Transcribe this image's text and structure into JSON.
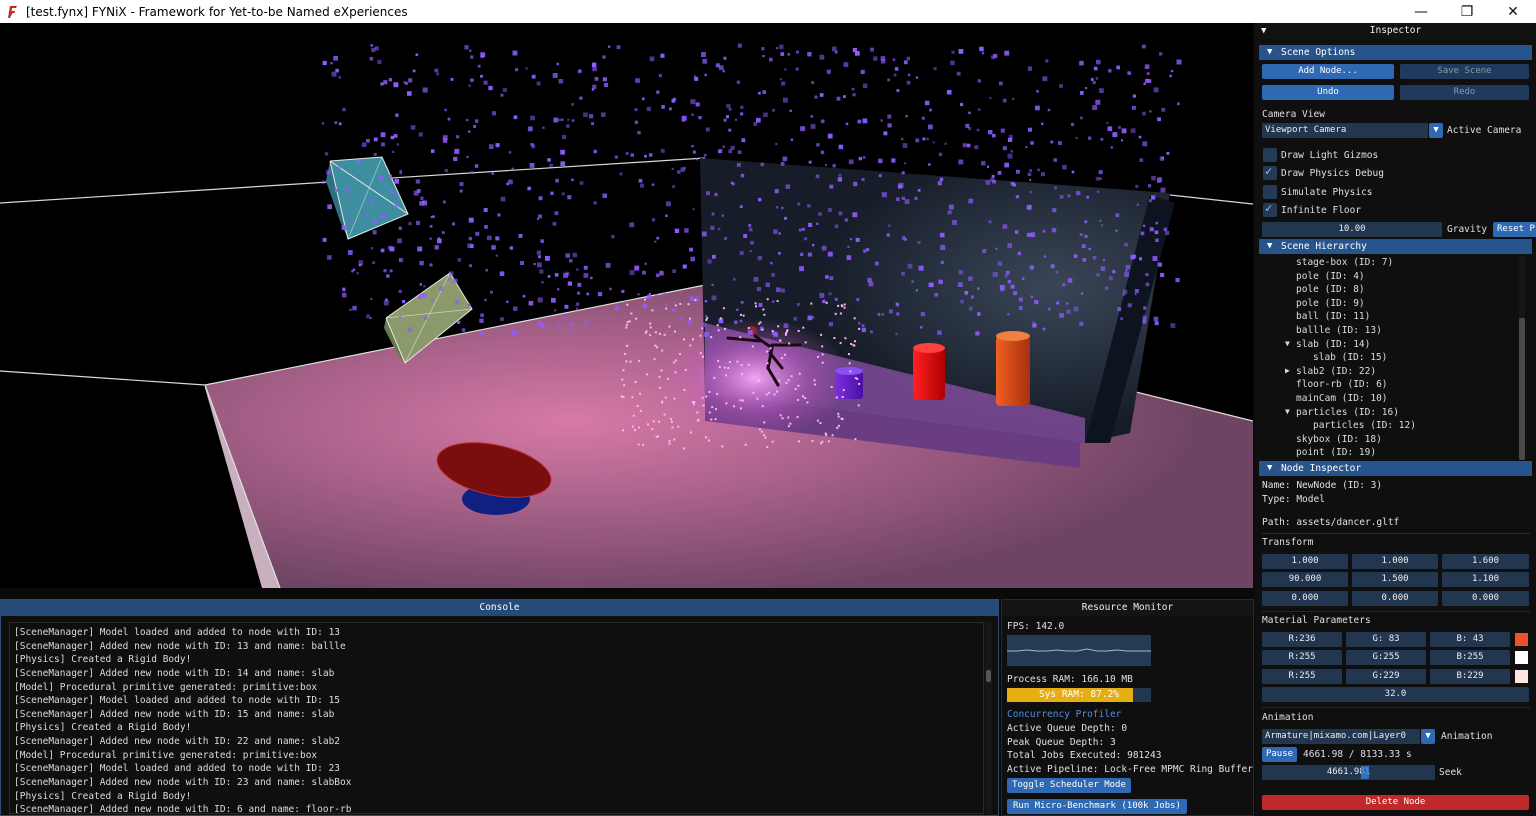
{
  "window": {
    "title": "[test.fynx] FYNiX - Framework for Yet-to-be Named eXperiences",
    "min_glyph": "—",
    "max_glyph": "❐",
    "close_glyph": "✕"
  },
  "inspector": {
    "title": "Inspector",
    "scene_options": {
      "header": "Scene Options",
      "add_node": "Add Node...",
      "save_scene": "Save Scene",
      "undo": "Undo",
      "redo": "Redo",
      "camera_view_label": "Camera View",
      "camera_select": "Viewport Camera",
      "active_camera_label": "Active Camera",
      "checkboxes": [
        {
          "label": "Draw Light Gizmos",
          "checked": false
        },
        {
          "label": "Draw Physics Debug",
          "checked": true
        },
        {
          "label": "Simulate Physics",
          "checked": false
        },
        {
          "label": "Infinite Floor",
          "checked": true
        }
      ],
      "gravity_value": "10.00",
      "gravity_label": "Gravity",
      "reset_label": "Reset P"
    },
    "scene_hierarchy": {
      "header": "Scene Hierarchy",
      "items": [
        {
          "label": "stage-box (ID: 7)",
          "depth": 0,
          "arrow": ""
        },
        {
          "label": "pole (ID: 4)",
          "depth": 0,
          "arrow": ""
        },
        {
          "label": "pole (ID: 8)",
          "depth": 0,
          "arrow": ""
        },
        {
          "label": "pole (ID: 9)",
          "depth": 0,
          "arrow": ""
        },
        {
          "label": "ball (ID: 11)",
          "depth": 0,
          "arrow": ""
        },
        {
          "label": "ballle (ID: 13)",
          "depth": 0,
          "arrow": ""
        },
        {
          "label": "slab (ID: 14)",
          "depth": 0,
          "arrow": "▼"
        },
        {
          "label": "slab (ID: 15)",
          "depth": 1,
          "arrow": ""
        },
        {
          "label": "slab2 (ID: 22)",
          "depth": 0,
          "arrow": "▶"
        },
        {
          "label": "floor-rb (ID: 6)",
          "depth": 0,
          "arrow": ""
        },
        {
          "label": "mainCam (ID: 10)",
          "depth": 0,
          "arrow": ""
        },
        {
          "label": "particles (ID: 16)",
          "depth": 0,
          "arrow": "▼"
        },
        {
          "label": "particles (ID: 12)",
          "depth": 1,
          "arrow": ""
        },
        {
          "label": "skybox (ID: 18)",
          "depth": 0,
          "arrow": ""
        },
        {
          "label": "point (ID: 19)",
          "depth": 0,
          "arrow": ""
        }
      ]
    },
    "node_inspector": {
      "header": "Node Inspector",
      "name": "Name: NewNode (ID: 3)",
      "type": "Type: Model",
      "path": "Path: assets/dancer.gltf",
      "transform_label": "Transform",
      "transform": [
        [
          "1.000",
          "1.000",
          "1.600"
        ],
        [
          "90.000",
          "1.500",
          "1.100"
        ],
        [
          "0.000",
          "0.000",
          "0.000"
        ]
      ],
      "material_label": "Material Parameters",
      "material": [
        {
          "r": "R:236",
          "g": "G: 83",
          "b": "B: 43",
          "color": "#ec532b"
        },
        {
          "r": "R:255",
          "g": "G:255",
          "b": "B:255",
          "color": "#ffffff"
        },
        {
          "r": "R:255",
          "g": "G:229",
          "b": "B:229",
          "color": "#ffe5e5"
        }
      ],
      "material_scalar": "32.0",
      "animation_label": "Animation",
      "animation_select": "Armature|mixamo.com|Layer0",
      "animation_select_label": "Animation",
      "pause": "Pause",
      "time": "4661.98 / 8133.33 s",
      "seek_value": "4661.981",
      "seek_label": "Seek",
      "delete_node": "Delete Node"
    }
  },
  "console": {
    "title": "Console",
    "lines": [
      "[SceneManager] Model loaded and added to node with ID: 13",
      "[SceneManager] Added new node with ID: 13 and name: ballle",
      "[Physics] Created a Rigid Body!",
      "[SceneManager] Added new node with ID: 14 and name: slab",
      "[Model] Procedural primitive generated: primitive:box",
      "[SceneManager] Model loaded and added to node with ID: 15",
      "[SceneManager] Added new node with ID: 15 and name: slab",
      "[Physics] Created a Rigid Body!",
      "[SceneManager] Added new node with ID: 22 and name: slab2",
      "[Model] Procedural primitive generated: primitive:box",
      "[SceneManager] Model loaded and added to node with ID: 23",
      "[SceneManager] Added new node with ID: 23 and name: slabBox",
      "[Physics] Created a Rigid Body!",
      "[SceneManager] Added new node with ID: 6 and name: floor-rb"
    ]
  },
  "resource_monitor": {
    "title": "Resource Monitor",
    "fps": "FPS: 142.0",
    "process_ram": "Process RAM: 166.10 MB",
    "sys_ram": "Sys RAM: 87.2%",
    "sys_ram_fraction": 0.872,
    "profiler_title": "Concurrency Profiler",
    "active_queue": "Active Queue Depth: 0",
    "peak_queue": "Peak Queue Depth: 3",
    "total_jobs": "Total Jobs Executed: 981243",
    "pipeline": "Active Pipeline: Lock-Free MPMC Ring Buffer",
    "toggle_scheduler": "Toggle Scheduler Mode",
    "run_benchmark": "Run Micro-Benchmark (100k Jobs)"
  },
  "colors": {
    "accent": "#28548c",
    "button": "#2f69b3",
    "delete": "#c0282a",
    "profiler_text": "#4f8fe0",
    "ram_bar": "#e6ae12"
  }
}
